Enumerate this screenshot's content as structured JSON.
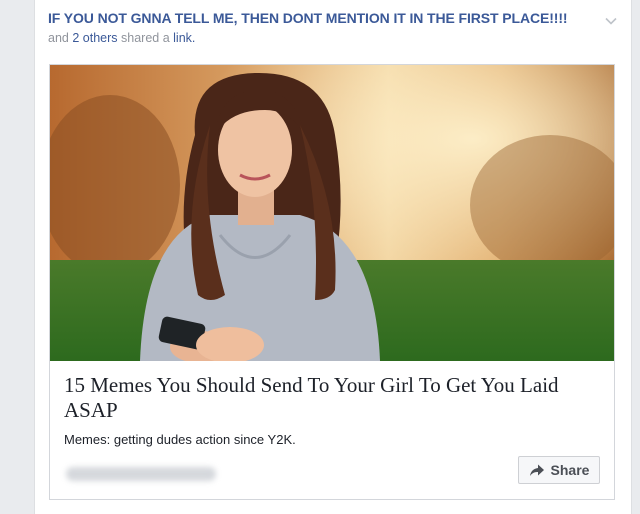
{
  "post": {
    "title": "IF YOU NOT GNNA TELL ME, THEN DONT MENTION IT IN THE FIRST PLACE!!!!",
    "subtitle_prefix": "and",
    "subtitle_others": "2 others",
    "subtitle_middle": "shared a",
    "subtitle_link": "link."
  },
  "link_preview": {
    "image_icon": "photo-of-woman-texting",
    "title": "15 Memes You Should Send To Your Girl To Get You Laid ASAP",
    "description": "Memes: getting dudes action since Y2K."
  },
  "actions": {
    "share_label": "Share",
    "share_icon": "share-arrow-icon"
  },
  "colors": {
    "accent": "#3b5998",
    "muted": "#90949c"
  }
}
